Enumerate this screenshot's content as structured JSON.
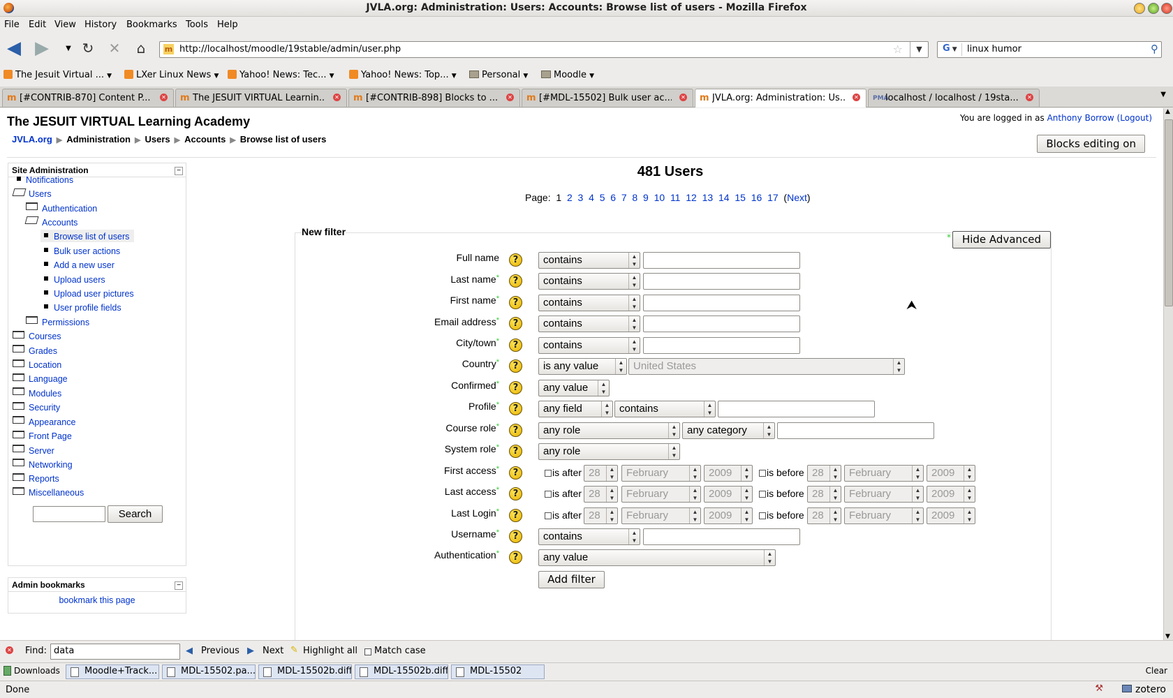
{
  "window": {
    "title": "JVLA.org: Administration: Users: Accounts: Browse list of users - Mozilla Firefox"
  },
  "menu": [
    "File",
    "Edit",
    "View",
    "History",
    "Bookmarks",
    "Tools",
    "Help"
  ],
  "nav": {
    "url": "http://localhost/moodle/19stable/admin/user.php",
    "search_query": "linux humor"
  },
  "bookmarks": [
    "The Jesuit Virtual ...",
    "LXer Linux News",
    "Yahoo! News: Tec...",
    "Yahoo! News: Top...",
    "Personal",
    "Moodle"
  ],
  "tabs": [
    {
      "label": "[#CONTRIB-870] Content P...",
      "icon": "m"
    },
    {
      "label": "The JESUIT VIRTUAL Learnin...",
      "icon": "m-hat"
    },
    {
      "label": "[#CONTRIB-898] Blocks to ...",
      "icon": "m"
    },
    {
      "label": "[#MDL-15502] Bulk user ac...",
      "icon": "m"
    },
    {
      "label": "JVLA.org: Administration: Us...",
      "icon": "m-hat"
    },
    {
      "label": "localhost / localhost / 19sta...",
      "icon": "pma"
    }
  ],
  "page": {
    "site_name": "The JESUIT VIRTUAL Learning Academy",
    "login_prefix": "You are logged in as",
    "user_name": "Anthony Borrow",
    "logout": "(Logout)",
    "breadcrumb": [
      "JVLA.org",
      "Administration",
      "Users",
      "Accounts",
      "Browse list of users"
    ],
    "blocks_button": "Blocks editing on",
    "heading": "481 Users",
    "page_label": "Page:",
    "current_page": "1",
    "pages": [
      "2",
      "3",
      "4",
      "5",
      "6",
      "7",
      "8",
      "9",
      "10",
      "11",
      "12",
      "13",
      "14",
      "15",
      "16",
      "17"
    ],
    "next": "Next"
  },
  "sidebar": {
    "title": "Site Administration",
    "collapse": "−",
    "items": {
      "notifications": "Notifications",
      "users": "Users",
      "authentication": "Authentication",
      "accounts": "Accounts",
      "browse": "Browse list of users",
      "bulk": "Bulk user actions",
      "add": "Add a new user",
      "upload": "Upload users",
      "upload_pictures": "Upload user pictures",
      "profile_fields": "User profile fields",
      "permissions": "Permissions",
      "courses": "Courses",
      "grades": "Grades",
      "location": "Location",
      "language": "Language",
      "modules": "Modules",
      "security": "Security",
      "appearance": "Appearance",
      "front_page": "Front Page",
      "server": "Server",
      "networking": "Networking",
      "reports": "Reports",
      "misc": "Miscellaneous"
    },
    "search_button": "Search",
    "bookmarks_title": "Admin bookmarks",
    "bookmark_link": "bookmark this page"
  },
  "filter": {
    "legend": "New filter",
    "hide_advanced": "Hide Advanced",
    "rows": {
      "fullname": "Full name",
      "lastname": "Last name",
      "firstname": "First name",
      "email": "Email address",
      "city": "City/town",
      "country": "Country",
      "confirmed": "Confirmed",
      "profile": "Profile",
      "course_role": "Course role",
      "system_role": "System role",
      "first_access": "First access",
      "last_access": "Last access",
      "last_login": "Last Login",
      "username": "Username",
      "auth": "Authentication"
    },
    "contains": "contains",
    "is_any_value": "is any value",
    "country_value": "United States",
    "any_value": "any value",
    "any_field": "any field",
    "any_role": "any role",
    "any_category": "any category",
    "is_after": "is after",
    "is_before": "is before",
    "day": "28",
    "month": "February",
    "year": "2009",
    "add_filter": "Add filter"
  },
  "findbar": {
    "label": "Find:",
    "query": "data",
    "previous": "Previous",
    "next": "Next",
    "highlight": "Highlight all",
    "match_case": "Match case"
  },
  "downloads": {
    "label": "Downloads",
    "items": [
      "Moodle+Track...",
      "MDL-15502.pa...",
      "MDL-15502b.diff",
      "MDL-15502b.diff",
      "MDL-15502"
    ],
    "clear": "Clear"
  },
  "status": {
    "text": "Done",
    "zotero": "zotero"
  },
  "colors": {
    "link": "#0033cc",
    "required": "#33cc33",
    "help": "#f4cc1d"
  }
}
